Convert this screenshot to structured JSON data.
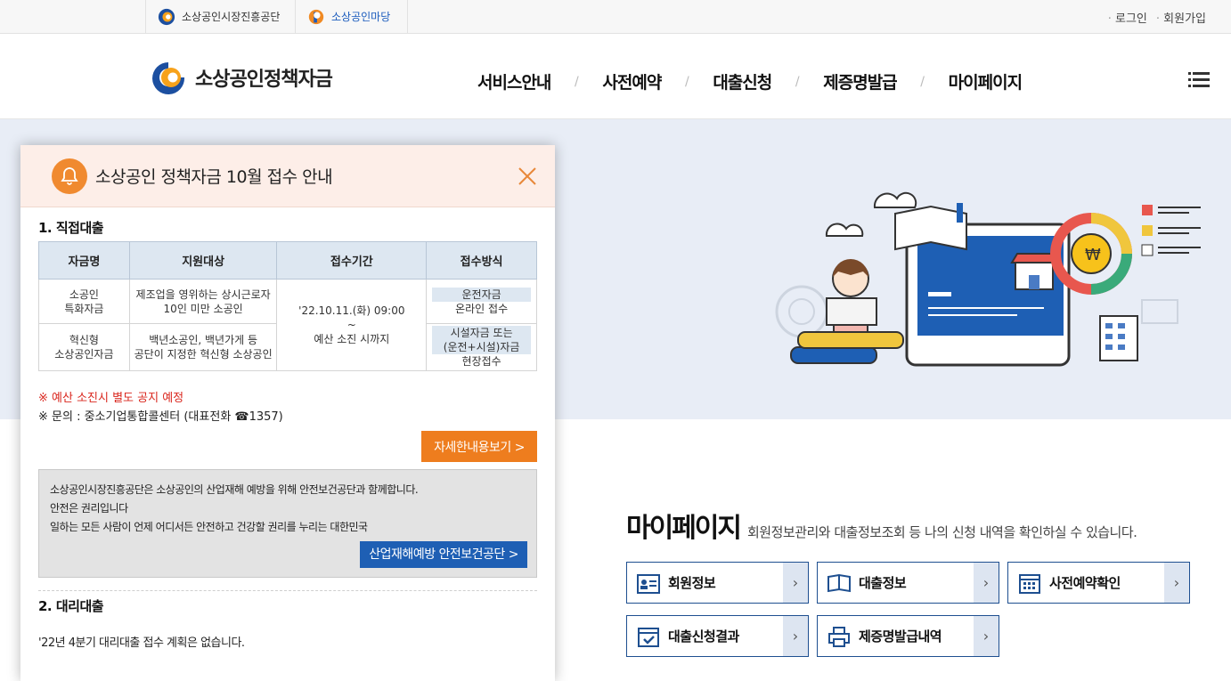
{
  "util": {
    "site1": "소상공인시장진흥공단",
    "site2": "소상공인마당",
    "login": "로그인",
    "join": "회원가입"
  },
  "header": {
    "brand": "소상공인정책자금",
    "nav": [
      "서비스안내",
      "사전예약",
      "대출신청",
      "제증명발급",
      "마이페이지"
    ],
    "menu_icon": "hamburger-menu-icon"
  },
  "popup": {
    "title": "소상공인 정책자금 10월 접수 안내",
    "section1": "1. 직접대출",
    "table": {
      "headers": [
        "자금명",
        "지원대상",
        "접수기간",
        "접수방식"
      ],
      "rows": [
        {
          "fund_line1": "소공인",
          "fund_line2": "특화자금",
          "target_line1": "제조업을 영위하는 상시근로자",
          "target_line2": "10인 미만 소공인",
          "method_hl": "운전자금",
          "method_text": "온라인 접수"
        },
        {
          "fund_line1": "혁신형",
          "fund_line2": "소상공인자금",
          "target_line1": "백년소공인, 백년가게 등",
          "target_line2": "공단이 지정한 혁신형 소상공인",
          "method_hl": "시설자금 또는",
          "method_hl2": "(운전+시설)자금",
          "method_text": "현장접수"
        }
      ],
      "period_line1": "'22.10.11.(화) 09:00",
      "period_line2": "~",
      "period_line3": "예산 소진 시까지"
    },
    "note_red": "※ 예산 소진시 별도 공지 예정",
    "note_contact": "※ 문의 : 중소기업통합콜센터 (대표전화 ☎1357)",
    "detail_button": "자세한내용보기 >",
    "safety": {
      "line1": "소상공인시장진흥공단은 소상공인의 산업재해 예방을 위해 안전보건공단과 함께합니다.",
      "line2": "안전은 권리입니다",
      "line3": "일하는 모든 사람이 언제 어디서든 안전하고 건강할 권리를 누리는 대한민국",
      "button": "산업재해예방 안전보건공단 >"
    },
    "section2": "2. 대리대출",
    "section2_text": "'22년 4분기 대리대출 접수 계획은 없습니다."
  },
  "mypage": {
    "title": "마이페이지",
    "desc": "회원정보관리와 대출정보조회 등 나의 신청 내역을 확인하실 수 있습니다.",
    "buttons": [
      "회원정보",
      "대출정보",
      "사전예약확인",
      "대출신청결과",
      "제증명발급내역"
    ]
  },
  "colors": {
    "navy": "#1e4f90",
    "orange": "#ee7d1e",
    "hero_bg": "#e8edf6",
    "red_note": "#d9251c"
  }
}
